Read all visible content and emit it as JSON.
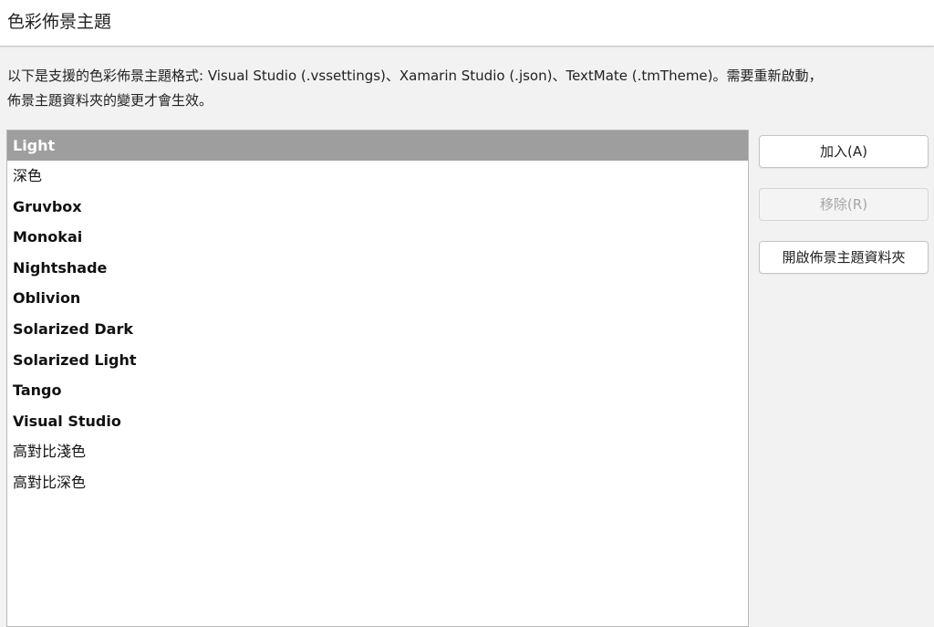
{
  "header": {
    "title": "色彩佈景主題"
  },
  "description": {
    "line1": "以下是支援的色彩佈景主題格式: Visual Studio (.vssettings)、Xamarin Studio (.json)、TextMate (.tmTheme)。需要重新啟動，",
    "line2": "佈景主題資料夾的變更才會生效。"
  },
  "themes": [
    {
      "label": "Light",
      "selected": true,
      "bold": true
    },
    {
      "label": "深色",
      "selected": false,
      "bold": false
    },
    {
      "label": "Gruvbox",
      "selected": false,
      "bold": true
    },
    {
      "label": "Monokai",
      "selected": false,
      "bold": true
    },
    {
      "label": "Nightshade",
      "selected": false,
      "bold": true
    },
    {
      "label": "Oblivion",
      "selected": false,
      "bold": true
    },
    {
      "label": "Solarized Dark",
      "selected": false,
      "bold": true
    },
    {
      "label": "Solarized Light",
      "selected": false,
      "bold": true
    },
    {
      "label": "Tango",
      "selected": false,
      "bold": true
    },
    {
      "label": "Visual Studio",
      "selected": false,
      "bold": true
    },
    {
      "label": "高對比淺色",
      "selected": false,
      "bold": false
    },
    {
      "label": "高對比深色",
      "selected": false,
      "bold": false
    }
  ],
  "buttons": {
    "add": "加入(A)",
    "remove": "移除(R)",
    "open_folder": "開啟佈景主題資料夾"
  },
  "colors": {
    "selection_bg": "#9e9e9e",
    "page_bg": "#f2f2f2",
    "disabled_text": "#a6a6a6"
  }
}
